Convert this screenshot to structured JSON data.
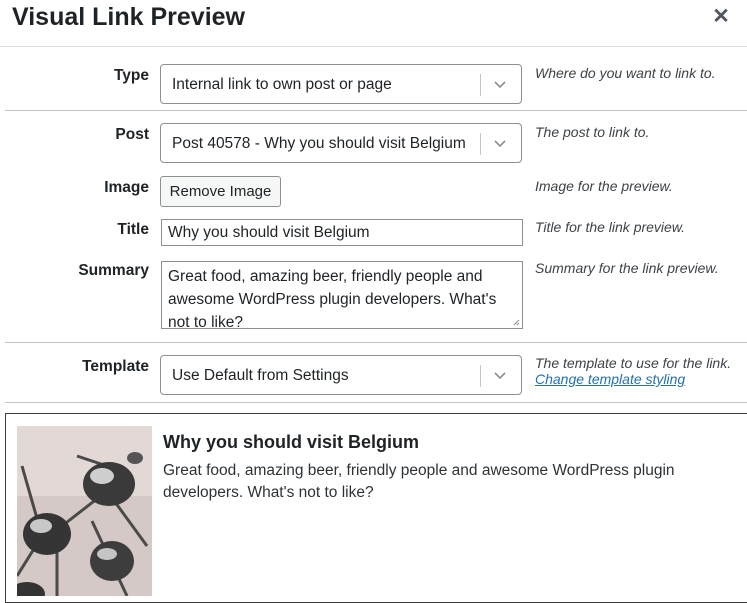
{
  "dialog": {
    "title": "Visual Link Preview",
    "close_icon": "close-icon"
  },
  "form": {
    "type": {
      "label": "Type",
      "value": "Internal link to own post or page",
      "help": "Where do you want to link to."
    },
    "post": {
      "label": "Post",
      "value": "Post 40578 - Why you should visit Belgium",
      "help": "The post to link to."
    },
    "image": {
      "label": "Image",
      "button": "Remove Image",
      "help": "Image for the preview."
    },
    "title": {
      "label": "Title",
      "value": "Why you should visit Belgium",
      "help": "Title for the link preview."
    },
    "summary": {
      "label": "Summary",
      "value": "Great food, amazing beer, friendly people and awesome WordPress plugin developers. What's not to like?",
      "help": "Summary for the link preview."
    },
    "template": {
      "label": "Template",
      "value": "Use Default from Settings",
      "help": "The template to use for the link.",
      "link": "Change template styling"
    }
  },
  "preview": {
    "title": "Why you should visit Belgium",
    "summary": "Great food, amazing beer, friendly people and awesome WordPress plugin developers. What's not to like?",
    "image_icon": "atomium-photo"
  },
  "colors": {
    "accent_link": "#2271b1",
    "border": "#8c8f94",
    "divider": "#c3c4c7"
  }
}
